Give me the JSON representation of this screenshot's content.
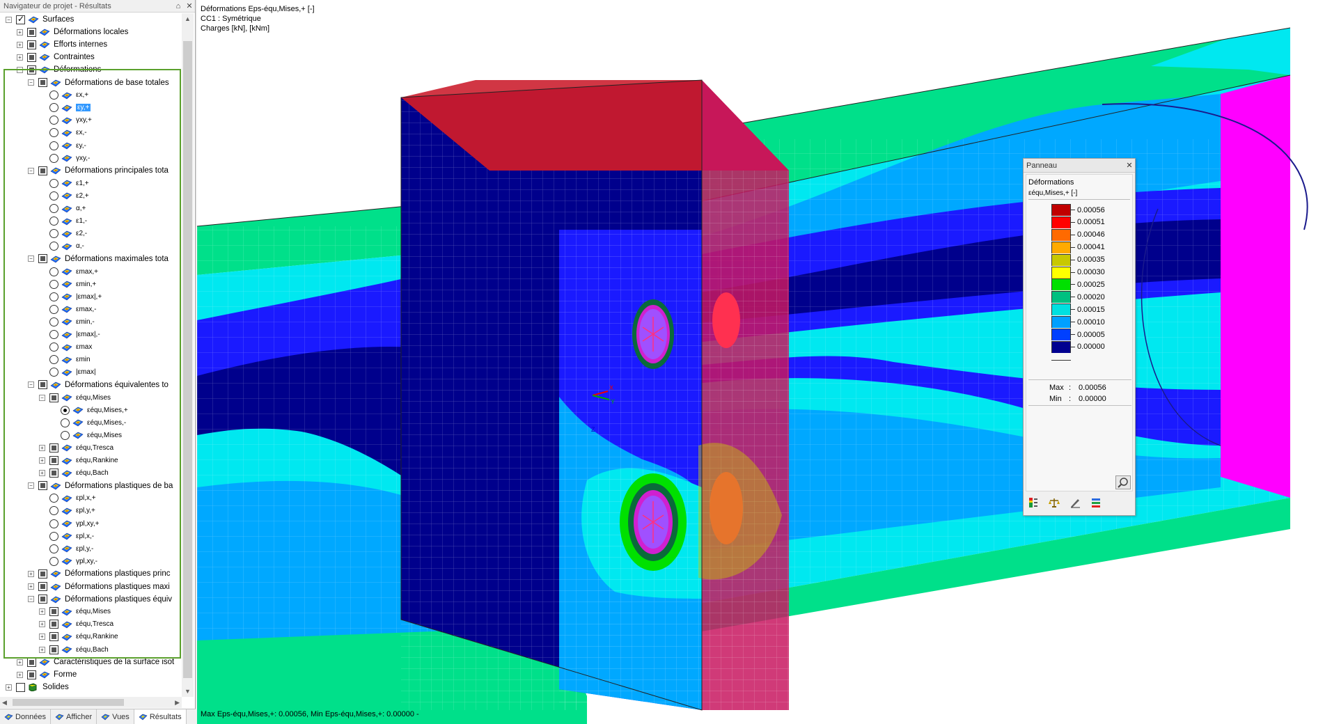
{
  "navigator": {
    "title": "Navigateur de projet - Résultats",
    "pin_glyph": "⌂",
    "close_glyph": "✕",
    "tree": [
      {
        "label": "Surfaces",
        "level": 0,
        "exp": "-",
        "check": "checked",
        "icon": "surfaces-icon"
      },
      {
        "label": "Déformations locales",
        "level": 1,
        "exp": "+",
        "check": "partial",
        "icon": "result-icon"
      },
      {
        "label": "Efforts internes",
        "level": 1,
        "exp": "+",
        "check": "partial",
        "icon": "result-icon"
      },
      {
        "label": "Contraintes",
        "level": 1,
        "exp": "+",
        "check": "partial",
        "icon": "result-icon"
      },
      {
        "label": "Déformations",
        "level": 1,
        "exp": "-",
        "check": "partial",
        "icon": "result-icon"
      },
      {
        "label": "Déformations de base totales",
        "level": 2,
        "exp": "-",
        "check": "partial",
        "icon": "result-icon"
      },
      {
        "label": "εx,+",
        "level": 3,
        "radio": "off",
        "icon": "result-icon",
        "small": true
      },
      {
        "label": "εy,+",
        "level": 3,
        "radio": "off",
        "icon": "result-icon",
        "small": true,
        "selected": true
      },
      {
        "label": "γxy,+",
        "level": 3,
        "radio": "off",
        "icon": "result-icon",
        "small": true
      },
      {
        "label": "εx,-",
        "level": 3,
        "radio": "off",
        "icon": "result-icon",
        "small": true
      },
      {
        "label": "εy,-",
        "level": 3,
        "radio": "off",
        "icon": "result-icon",
        "small": true
      },
      {
        "label": "γxy,-",
        "level": 3,
        "radio": "off",
        "icon": "result-icon",
        "small": true
      },
      {
        "label": "Déformations principales tota",
        "level": 2,
        "exp": "-",
        "check": "partial",
        "icon": "result-icon"
      },
      {
        "label": "ε1,+",
        "level": 3,
        "radio": "off",
        "icon": "result-icon",
        "small": true
      },
      {
        "label": "ε2,+",
        "level": 3,
        "radio": "off",
        "icon": "result-icon",
        "small": true
      },
      {
        "label": "α,+",
        "level": 3,
        "radio": "off",
        "icon": "result-icon",
        "small": true
      },
      {
        "label": "ε1,-",
        "level": 3,
        "radio": "off",
        "icon": "result-icon",
        "small": true
      },
      {
        "label": "ε2,-",
        "level": 3,
        "radio": "off",
        "icon": "result-icon",
        "small": true
      },
      {
        "label": "α,-",
        "level": 3,
        "radio": "off",
        "icon": "result-icon",
        "small": true
      },
      {
        "label": "Déformations maximales tota",
        "level": 2,
        "exp": "-",
        "check": "partial",
        "icon": "result-icon"
      },
      {
        "label": "εmax,+",
        "level": 3,
        "radio": "off",
        "icon": "result-icon",
        "small": true
      },
      {
        "label": "εmin,+",
        "level": 3,
        "radio": "off",
        "icon": "result-icon",
        "small": true
      },
      {
        "label": "|εmax|,+",
        "level": 3,
        "radio": "off",
        "icon": "result-icon",
        "small": true
      },
      {
        "label": "εmax,-",
        "level": 3,
        "radio": "off",
        "icon": "result-icon",
        "small": true
      },
      {
        "label": "εmin,-",
        "level": 3,
        "radio": "off",
        "icon": "result-icon",
        "small": true
      },
      {
        "label": "|εmax|,-",
        "level": 3,
        "radio": "off",
        "icon": "result-icon",
        "small": true
      },
      {
        "label": "εmax",
        "level": 3,
        "radio": "off",
        "icon": "result-icon",
        "small": true
      },
      {
        "label": "εmin",
        "level": 3,
        "radio": "off",
        "icon": "result-icon",
        "small": true
      },
      {
        "label": "|εmax|",
        "level": 3,
        "radio": "off",
        "icon": "result-icon",
        "small": true
      },
      {
        "label": "Déformations équivalentes to",
        "level": 2,
        "exp": "-",
        "check": "partial",
        "icon": "result-icon"
      },
      {
        "label": "εéqu,Mises",
        "level": 3,
        "exp": "-",
        "check": "partial",
        "icon": "result-icon",
        "small": true
      },
      {
        "label": "εéqu,Mises,+",
        "level": 4,
        "radio": "on",
        "icon": "result-icon",
        "small": true
      },
      {
        "label": "εéqu,Mises,-",
        "level": 4,
        "radio": "off",
        "icon": "result-icon",
        "small": true
      },
      {
        "label": "εéqu,Mises",
        "level": 4,
        "radio": "off",
        "icon": "result-icon",
        "small": true
      },
      {
        "label": "εéqu,Tresca",
        "level": 3,
        "exp": "+",
        "check": "partial",
        "icon": "result-icon",
        "small": true
      },
      {
        "label": "εéqu,Rankine",
        "level": 3,
        "exp": "+",
        "check": "partial",
        "icon": "result-icon",
        "small": true
      },
      {
        "label": "εéqu,Bach",
        "level": 3,
        "exp": "+",
        "check": "partial",
        "icon": "result-icon",
        "small": true
      },
      {
        "label": "Déformations plastiques de ba",
        "level": 2,
        "exp": "-",
        "check": "partial",
        "icon": "result-icon"
      },
      {
        "label": "εpl,x,+",
        "level": 3,
        "radio": "off",
        "icon": "result-icon",
        "small": true
      },
      {
        "label": "εpl,y,+",
        "level": 3,
        "radio": "off",
        "icon": "result-icon",
        "small": true
      },
      {
        "label": "γpl,xy,+",
        "level": 3,
        "radio": "off",
        "icon": "result-icon",
        "small": true
      },
      {
        "label": "εpl,x,-",
        "level": 3,
        "radio": "off",
        "icon": "result-icon",
        "small": true
      },
      {
        "label": "εpl,y,-",
        "level": 3,
        "radio": "off",
        "icon": "result-icon",
        "small": true
      },
      {
        "label": "γpl,xy,-",
        "level": 3,
        "radio": "off",
        "icon": "result-icon",
        "small": true
      },
      {
        "label": "Déformations plastiques princ",
        "level": 2,
        "exp": "+",
        "check": "partial",
        "icon": "result-icon"
      },
      {
        "label": "Déformations plastiques maxi",
        "level": 2,
        "exp": "+",
        "check": "partial",
        "icon": "result-icon"
      },
      {
        "label": "Déformations plastiques équiv",
        "level": 2,
        "exp": "-",
        "check": "partial",
        "icon": "result-icon"
      },
      {
        "label": "εéqu,Mises",
        "level": 3,
        "exp": "+",
        "check": "partial",
        "icon": "result-icon",
        "small": true
      },
      {
        "label": "εéqu,Tresca",
        "level": 3,
        "exp": "+",
        "check": "partial",
        "icon": "result-icon",
        "small": true
      },
      {
        "label": "εéqu,Rankine",
        "level": 3,
        "exp": "+",
        "check": "partial",
        "icon": "result-icon",
        "small": true
      },
      {
        "label": "εéqu,Bach",
        "level": 3,
        "exp": "+",
        "check": "partial",
        "icon": "result-icon",
        "small": true
      },
      {
        "label": "Caractéristiques de la surface isot",
        "level": 1,
        "exp": "+",
        "check": "partial",
        "icon": "result-icon"
      },
      {
        "label": "Forme",
        "level": 1,
        "exp": "+",
        "check": "partial",
        "icon": "result-icon"
      },
      {
        "label": "Solides",
        "level": 0,
        "exp": "+",
        "check": "none",
        "icon": "solids-icon"
      }
    ],
    "tabs": [
      {
        "label": "Données",
        "icon": "data-icon"
      },
      {
        "label": "Afficher",
        "icon": "display-icon"
      },
      {
        "label": "Vues",
        "icon": "views-icon"
      },
      {
        "label": "Résultats",
        "icon": "results-icon",
        "active": true
      }
    ]
  },
  "viewport": {
    "info_lines": [
      "Déformations Eps-équ,Mises,+ [-]",
      "CC1 : Symétrique",
      "Charges [kN], [kNm]"
    ],
    "status": "Max Eps-équ,Mises,+: 0.00056, Min Eps-équ,Mises,+: 0.00000 -",
    "axes": {
      "x": "X",
      "y": "Y",
      "z": "Z"
    }
  },
  "panel": {
    "title": "Panneau",
    "close_glyph": "✕",
    "heading": "Déformations",
    "subheading": "εéqu,Mises,+ [-]",
    "legend": [
      {
        "value": "0.00056",
        "color": "#c00000"
      },
      {
        "value": "0.00051",
        "color": "#ff0000"
      },
      {
        "value": "0.00046",
        "color": "#ff6a00"
      },
      {
        "value": "0.00041",
        "color": "#ffaa00"
      },
      {
        "value": "0.00035",
        "color": "#c8c800"
      },
      {
        "value": "0.00030",
        "color": "#ffff00"
      },
      {
        "value": "0.00025",
        "color": "#00e000"
      },
      {
        "value": "0.00020",
        "color": "#00c080"
      },
      {
        "value": "0.00015",
        "color": "#00e0e0"
      },
      {
        "value": "0.00010",
        "color": "#00a0ff"
      },
      {
        "value": "0.00005",
        "color": "#0040ff"
      },
      {
        "value": "0.00000",
        "color": "#000090"
      }
    ],
    "max_label": "Max",
    "max_value": "0.00056",
    "min_label": "Min",
    "min_value": "0.00000",
    "colon": ":",
    "tools": [
      "color-scale-icon",
      "balance-icon",
      "pencil-icon",
      "bars-icon"
    ]
  },
  "colors": {
    "accent_frame": "#5aa02c",
    "selection": "#3399ff",
    "deep_blue": "#00008c",
    "blue": "#1a1aff",
    "cyan": "#00e8f0",
    "green": "#00e08a",
    "magenta": "#ff00ff",
    "red": "#cc2030"
  }
}
